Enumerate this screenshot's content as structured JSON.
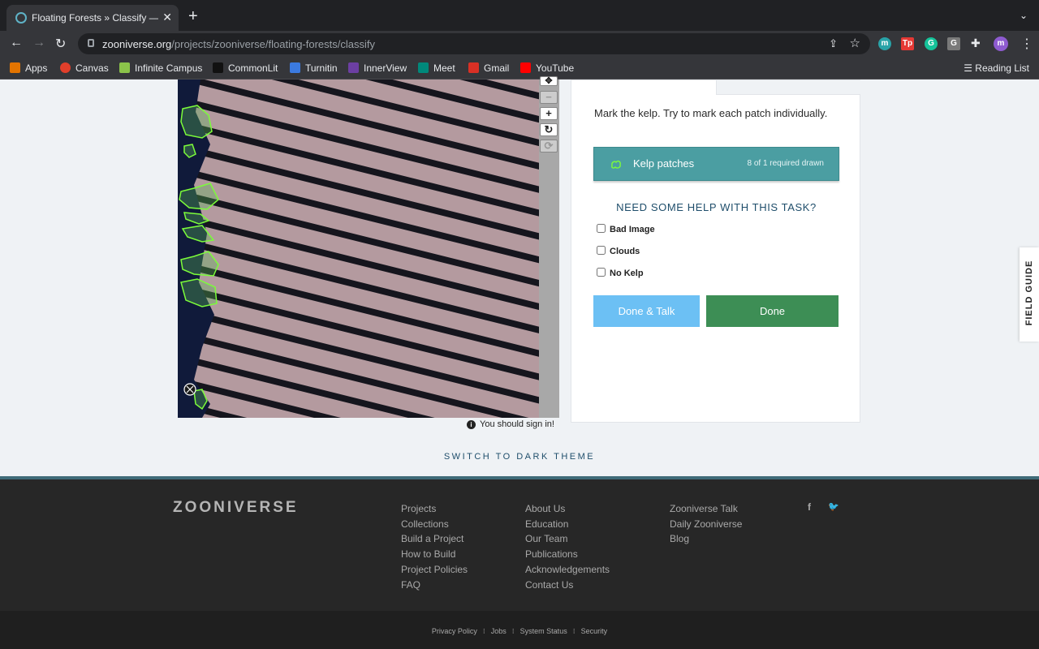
{
  "browser": {
    "tab_title": "Floating Forests » Classify — Z",
    "tab_close": "✕",
    "new_tab": "+",
    "tab_menu": "⌄",
    "url_host": "zooniverse.org",
    "url_path": "/projects/zooniverse/floating-forests/classify",
    "extensions": [
      {
        "letter": "m",
        "color": "#29a3a8"
      },
      {
        "letter": "Tp",
        "color": "#e53935"
      },
      {
        "letter": "G",
        "color": "#15c39a"
      },
      {
        "letter": "G",
        "color": "#7a7a7a"
      },
      {
        "letter": "m",
        "color": "#8e5bd0"
      }
    ],
    "bookmarks": [
      {
        "label": "Apps",
        "color": "#e37400"
      },
      {
        "label": "Canvas",
        "color": "#e13f2b"
      },
      {
        "label": "Infinite Campus",
        "color": "#8bc34a"
      },
      {
        "label": "CommonLit",
        "color": "#111111"
      },
      {
        "label": "Turnitin",
        "color": "#3b7ae0"
      },
      {
        "label": "InnerView",
        "color": "#6c3fa3"
      },
      {
        "label": "Meet",
        "color": "#00897b"
      },
      {
        "label": "Gmail",
        "color": "#d93025"
      },
      {
        "label": "YouTube",
        "color": "#ff0000"
      }
    ],
    "reading_list": "Reading List"
  },
  "viewer": {
    "sign_in_notice": "You should sign in!",
    "zoom_buttons": [
      "✥",
      "−",
      "+",
      "↻",
      "⟳"
    ]
  },
  "task": {
    "instruction": "Mark the kelp. Try to mark each patch individually.",
    "tool_label": "Kelp patches",
    "tool_count": "8 of 1 required drawn",
    "help_heading": "NEED SOME HELP WITH THIS TASK?",
    "checkboxes": [
      {
        "label": "Bad Image",
        "checked": false
      },
      {
        "label": "Clouds",
        "checked": false
      },
      {
        "label": "No Kelp",
        "checked": false
      }
    ],
    "done_talk_label": "Done & Talk",
    "done_label": "Done"
  },
  "field_guide": "FIELD GUIDE",
  "theme_switch": "SWITCH TO DARK THEME",
  "footer": {
    "logo": "ZOONIVERSE",
    "col1": [
      "Projects",
      "Collections",
      "Build a Project",
      "How to Build",
      "Project Policies",
      "FAQ"
    ],
    "col2": [
      "About Us",
      "Education",
      "Our Team",
      "Publications",
      "Acknowledgements",
      "Contact Us"
    ],
    "col3": [
      "Zooniverse Talk",
      "Daily Zooniverse",
      "Blog"
    ],
    "social": [
      "f",
      "🐦"
    ],
    "legal": [
      "Privacy Policy",
      "Jobs",
      "System Status",
      "Security"
    ]
  },
  "colors": {
    "teal_tool": "#4b9ea2",
    "done_green": "#3d8e55",
    "done_talk_blue": "#6cc0f4",
    "kelp_outline": "#7cfc3a"
  }
}
